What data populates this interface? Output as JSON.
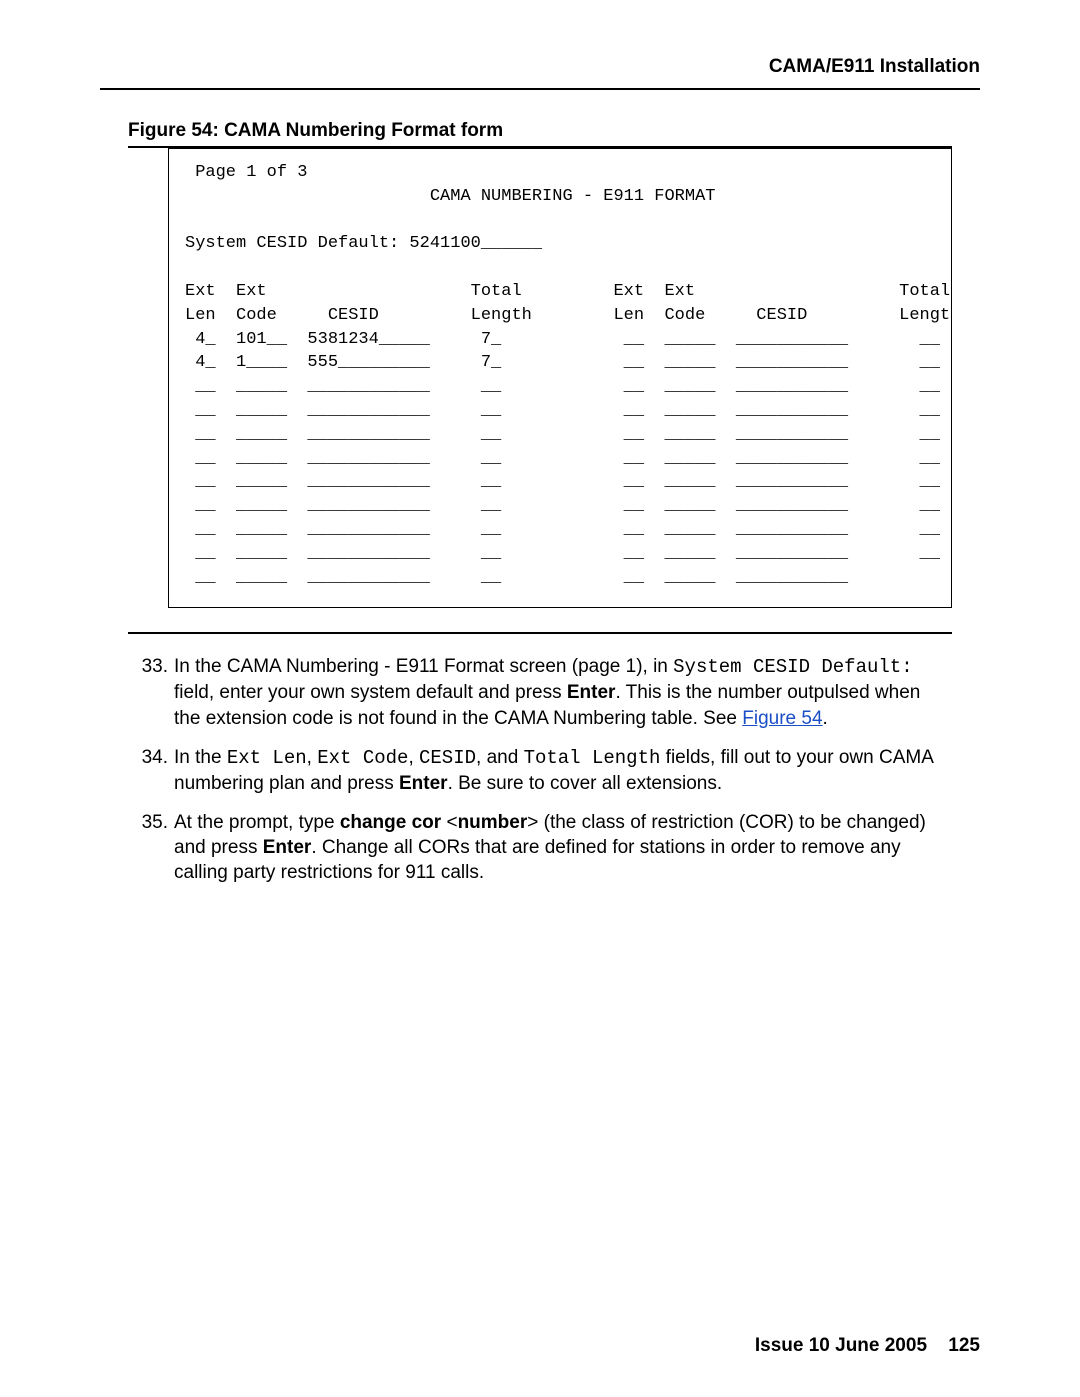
{
  "header": {
    "section_title": "CAMA/E911 Installation"
  },
  "figure": {
    "caption": "Figure 54: CAMA Numbering Format form",
    "terminal_text": " Page 1 of 3\n                        CAMA NUMBERING - E911 FORMAT\n\nSystem CESID Default: 5241100______\n\nExt  Ext                    Total         Ext  Ext                    Total\nLen  Code     CESID         Length        Len  Code     CESID         Length\n 4_  101__  5381234_____     7_            __  _____  ___________       __\n 4_  1____  555_________     7_            __  _____  ___________       __\n __  _____  ____________     __            __  _____  ___________       __\n __  _____  ____________     __            __  _____  ___________       __\n __  _____  ____________     __            __  _____  ___________       __\n __  _____  ____________     __            __  _____  ___________       __\n __  _____  ____________     __            __  _____  ___________       __\n __  _____  ____________     __            __  _____  ___________       __\n __  _____  ____________     __            __  _____  ___________       __\n __  _____  ____________     __            __  _____  ___________       __\n __  _____  ____________     __            __  _____  ___________"
  },
  "steps": {
    "s33_num": "33.",
    "s33_t1": "In the CAMA Numbering - E911 Format screen (page 1), in ",
    "s33_mono1": "System CESID Default:",
    "s33_t2": " field, enter your own system default and press ",
    "s33_bold1": "Enter",
    "s33_t3": ". This is the number outpulsed when the extension code is not found in the CAMA Numbering table. See ",
    "s33_link": "Figure 54",
    "s33_t4": ".",
    "s34_num": "34.",
    "s34_t1": "In the ",
    "s34_mono1": "Ext Len",
    "s34_t2": ", ",
    "s34_mono2": "Ext Code",
    "s34_t3": ", ",
    "s34_mono3": "CESID",
    "s34_t4": ", and ",
    "s34_mono4": "Total Length",
    "s34_t5": " fields, fill out to your own CAMA numbering plan and press ",
    "s34_bold1": "Enter",
    "s34_t6": ". Be sure to cover all extensions.",
    "s35_num": "35.",
    "s35_t1": "At the prompt, type ",
    "s35_bold1": "change cor",
    "s35_t2": " <",
    "s35_bold2": "number",
    "s35_t3": "> (the class of restriction (COR) to be changed) and press ",
    "s35_bold3": "Enter",
    "s35_t4": ". Change all CORs that are defined for stations in order to remove any calling party restrictions for 911 calls."
  },
  "footer": {
    "issue": "Issue 10   June 2005",
    "page": "125"
  }
}
